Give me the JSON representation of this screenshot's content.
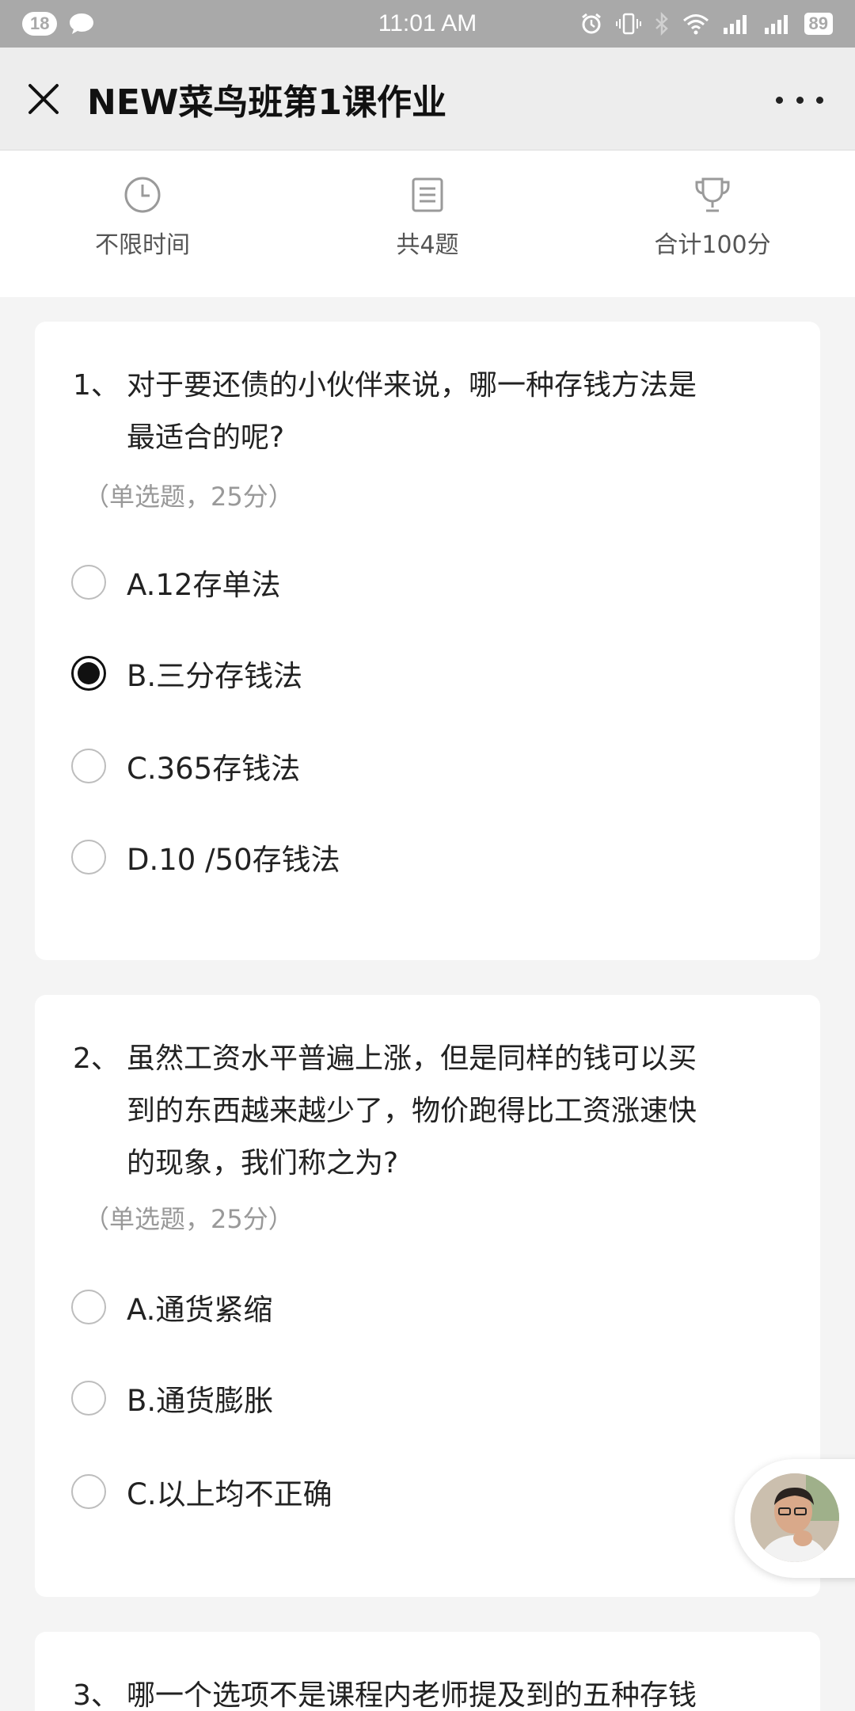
{
  "status_bar": {
    "notification_count": "18",
    "time": "11:01 AM",
    "battery": "89"
  },
  "header": {
    "title": "NEW菜鸟班第1课作业"
  },
  "info": {
    "time_limit": "不限时间",
    "question_count": "共4题",
    "total_score": "合计100分"
  },
  "questions": [
    {
      "number": "1、",
      "text_lines": [
        "对于要还债的小伙伴来说，哪一种存钱方法是",
        "最适合的呢?"
      ],
      "meta": "（单选题，25分）",
      "options": [
        {
          "label": "A.12存单法",
          "selected": false
        },
        {
          "label": "B.三分存钱法",
          "selected": true
        },
        {
          "label": "C.365存钱法",
          "selected": false
        },
        {
          "label": "D.10 /50存钱法",
          "selected": false
        }
      ]
    },
    {
      "number": "2、",
      "text_lines": [
        "虽然工资水平普遍上涨，但是同样的钱可以买",
        "到的东西越来越少了，物价跑得比工资涨速快",
        "的现象，我们称之为?"
      ],
      "meta": "（单选题，25分）",
      "options": [
        {
          "label": "A.通货紧缩",
          "selected": false
        },
        {
          "label": "B.通货膨胀",
          "selected": false
        },
        {
          "label": "C.以上均不正确",
          "selected": false
        }
      ]
    },
    {
      "number": "3、",
      "text_lines": [
        "哪一个选项不是课程内老师提及到的五种存钱"
      ]
    }
  ],
  "colors": {
    "status_bar_bg": "#a9a9a9",
    "title_bar_bg": "#ededed",
    "page_bg": "#f4f4f4",
    "selected_radio": "#111111"
  }
}
